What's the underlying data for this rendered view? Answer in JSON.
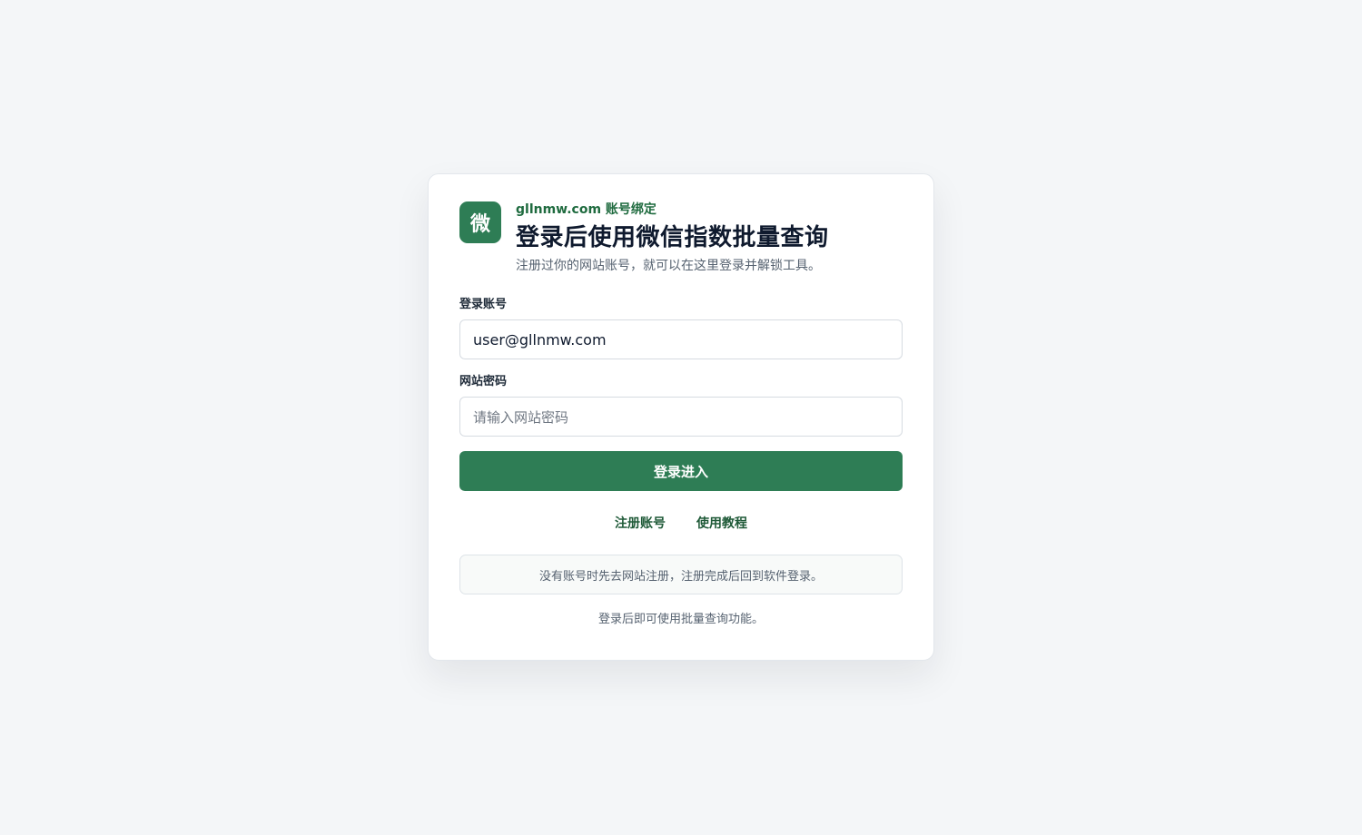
{
  "logo": {
    "glyph": "微",
    "color": "#2e7d55"
  },
  "header": {
    "eyebrow": "gllnmw.com 账号绑定",
    "title": "登录后使用微信指数批量查询",
    "subtitle": "注册过你的网站账号，就可以在这里登录并解锁工具。"
  },
  "form": {
    "account_label": "登录账号",
    "account_value": "user@gllnmw.com",
    "password_label": "网站密码",
    "password_placeholder": "请输入网站密码",
    "submit_label": "登录进入"
  },
  "links": {
    "register": "注册账号",
    "tutorial": "使用教程"
  },
  "notice": "没有账号时先去网站注册，注册完成后回到软件登录。",
  "footer_note": "登录后即可使用批量查询功能。",
  "colors": {
    "accent": "#2e7d55",
    "background": "#f4f6f8"
  }
}
